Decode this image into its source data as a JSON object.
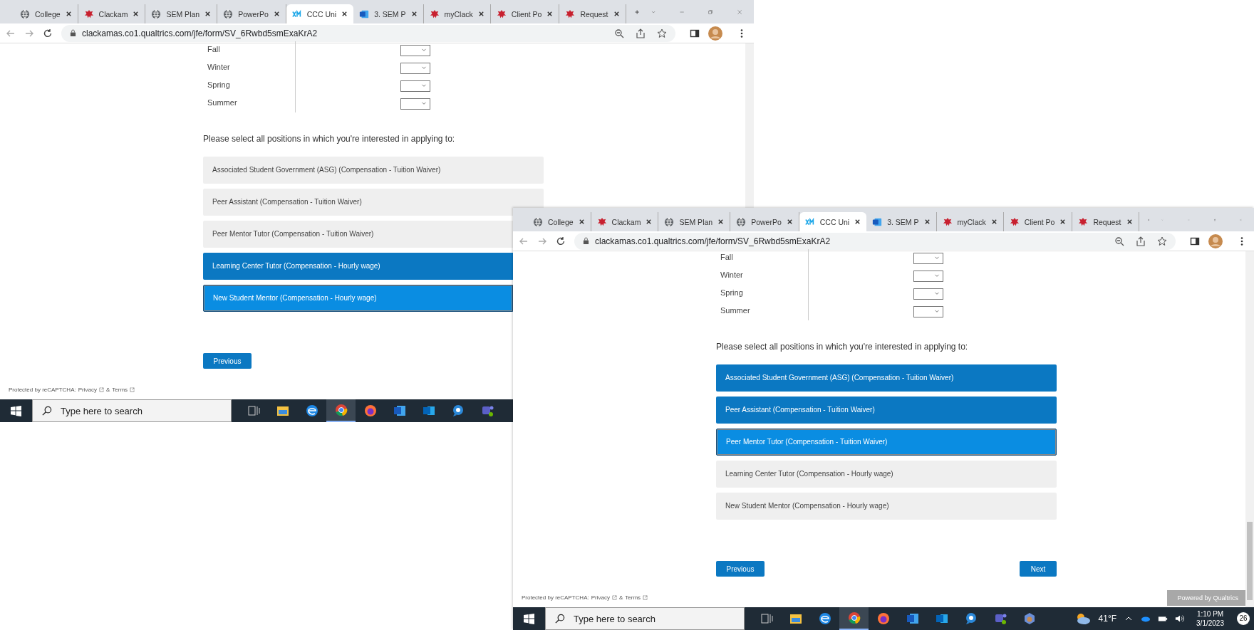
{
  "windows": [
    {
      "tabs": [
        {
          "title": "College",
          "kind": "globe",
          "selected": false
        },
        {
          "title": "Clackam",
          "kind": "crest",
          "selected": false
        },
        {
          "title": "SEM Plan",
          "kind": "globe",
          "selected": false
        },
        {
          "title": "PowerPo",
          "kind": "globe",
          "selected": false
        },
        {
          "title": "CCC Uni",
          "kind": "xm",
          "selected": true
        },
        {
          "title": "3. SEM P",
          "kind": "word",
          "selected": false
        },
        {
          "title": "myClack",
          "kind": "crest",
          "selected": false
        },
        {
          "title": "Client Po",
          "kind": "crest",
          "selected": false
        },
        {
          "title": "Request",
          "kind": "crest",
          "selected": false
        }
      ],
      "address": "clackamas.co1.qualtrics.com/jfe/form/SV_6Rwbd5smExaKrA2",
      "terms": [
        "Fall",
        "Winter",
        "Spring",
        "Summer"
      ],
      "prompt": "Please select all positions in which you're interested in applying to:",
      "options": [
        {
          "label": "Associated Student Government (ASG) (Compensation - Tuition Waiver)",
          "selected": false,
          "focused": false
        },
        {
          "label": "Peer Assistant (Compensation - Tuition Waiver)",
          "selected": false,
          "focused": false
        },
        {
          "label": "Peer Mentor Tutor (Compensation - Tuition Waiver)",
          "selected": false,
          "focused": false
        },
        {
          "label": "Learning Center Tutor (Compensation - Hourly wage)",
          "selected": true,
          "focused": false
        },
        {
          "label": "New Student Mentor (Compensation - Hourly wage)",
          "selected": true,
          "focused": true
        }
      ],
      "buttons": [
        {
          "label": "Previous",
          "kind": "previous"
        }
      ],
      "recaptcha": {
        "text": "Protected by reCAPTCHA:",
        "privacy": "Privacy",
        "amp": "&",
        "terms": "Terms"
      },
      "taskbar": {
        "search_placeholder": "Type here to search",
        "apps": [
          {
            "kind": "taskview",
            "active": false
          },
          {
            "kind": "explorer",
            "active": false
          },
          {
            "kind": "edge",
            "active": false
          },
          {
            "kind": "chrome",
            "active": true
          },
          {
            "kind": "firefox",
            "active": false
          },
          {
            "kind": "word",
            "active": false
          },
          {
            "kind": "outlook",
            "active": false
          },
          {
            "kind": "chat",
            "active": false
          },
          {
            "kind": "teams",
            "active": false
          }
        ]
      }
    },
    {
      "tabs": [
        {
          "title": "College",
          "kind": "globe",
          "selected": false
        },
        {
          "title": "Clackam",
          "kind": "crest",
          "selected": false
        },
        {
          "title": "SEM Plan",
          "kind": "globe",
          "selected": false
        },
        {
          "title": "PowerPo",
          "kind": "globe",
          "selected": false
        },
        {
          "title": "CCC Uni",
          "kind": "xm",
          "selected": true
        },
        {
          "title": "3. SEM P",
          "kind": "word",
          "selected": false
        },
        {
          "title": "myClack",
          "kind": "crest",
          "selected": false
        },
        {
          "title": "Client Po",
          "kind": "crest",
          "selected": false
        },
        {
          "title": "Request",
          "kind": "crest",
          "selected": false
        }
      ],
      "address": "clackamas.co1.qualtrics.com/jfe/form/SV_6Rwbd5smExaKrA2",
      "terms": [
        "Fall",
        "Winter",
        "Spring",
        "Summer"
      ],
      "prompt": "Please select all positions in which you're interested in applying to:",
      "options": [
        {
          "label": "Associated Student Government (ASG) (Compensation - Tuition Waiver)",
          "selected": true,
          "focused": false
        },
        {
          "label": "Peer Assistant (Compensation - Tuition Waiver)",
          "selected": true,
          "focused": false
        },
        {
          "label": "Peer Mentor Tutor (Compensation - Tuition Waiver)",
          "selected": true,
          "focused": true
        },
        {
          "label": "Learning Center Tutor (Compensation - Hourly wage)",
          "selected": false,
          "focused": false
        },
        {
          "label": "New Student Mentor (Compensation - Hourly wage)",
          "selected": false,
          "focused": false
        }
      ],
      "buttons": [
        {
          "label": "Previous",
          "kind": "previous"
        },
        {
          "label": "Next",
          "kind": "next"
        }
      ],
      "recaptcha": {
        "text": "Protected by reCAPTCHA:",
        "privacy": "Privacy",
        "amp": "&",
        "terms": "Terms"
      },
      "powered": "Powered by Qualtrics",
      "taskbar": {
        "search_placeholder": "Type here to search",
        "apps": [
          {
            "kind": "taskview",
            "active": false
          },
          {
            "kind": "explorer",
            "active": false
          },
          {
            "kind": "edge",
            "active": false
          },
          {
            "kind": "chrome",
            "active": true
          },
          {
            "kind": "firefox",
            "active": false
          },
          {
            "kind": "word",
            "active": false
          },
          {
            "kind": "outlook",
            "active": false
          },
          {
            "kind": "chat",
            "active": false
          },
          {
            "kind": "teams",
            "active": false
          },
          {
            "kind": "copilot",
            "active": false
          }
        ],
        "tray": {
          "temperature": "41°F",
          "time": "1:10 PM",
          "date": "3/1/2023",
          "notifications": "26"
        }
      }
    }
  ]
}
